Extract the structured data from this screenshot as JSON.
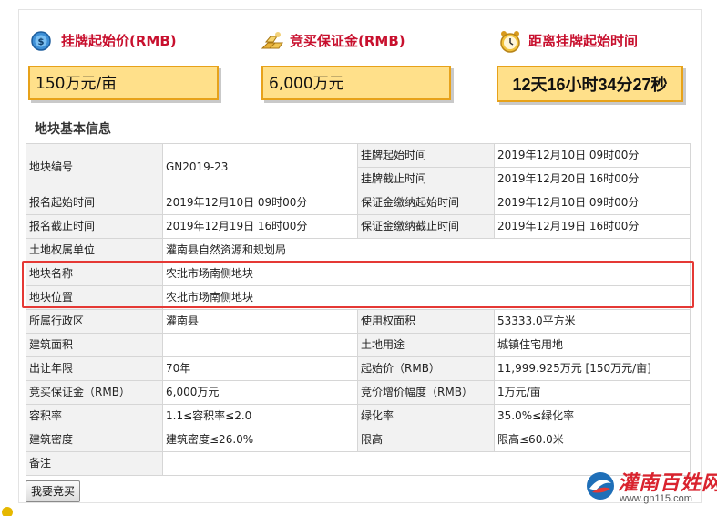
{
  "top": {
    "start_price": {
      "title": "挂牌起始价(RMB)",
      "value": "150万元/亩",
      "icon": "money-coin-icon"
    },
    "deposit": {
      "title": "竞买保证金(RMB)",
      "value": "6,000万元",
      "icon": "gold-bars-icon"
    },
    "countdown": {
      "title": "距离挂牌起始时间",
      "value": "12天16小时34分27秒",
      "icon": "alarm-clock-icon"
    }
  },
  "section_title": "地块基本信息",
  "table": {
    "parcel_no_label": "地块编号",
    "parcel_no": "GN2019-23",
    "listing_start_label": "挂牌起始时间",
    "listing_start": "2019年12月10日 09时00分",
    "listing_end_label": "挂牌截止时间",
    "listing_end": "2019年12月20日 16时00分",
    "reg_start_label": "报名起始时间",
    "reg_start": "2019年12月10日 09时00分",
    "deposit_start_label": "保证金缴纳起始时间",
    "deposit_start": "2019年12月10日 09时00分",
    "reg_end_label": "报名截止时间",
    "reg_end": "2019年12月19日 16时00分",
    "deposit_end_label": "保证金缴纳截止时间",
    "deposit_end": "2019年12月19日 16时00分",
    "owner_label": "土地权属单位",
    "owner": "灌南县自然资源和规划局",
    "name_label": "地块名称",
    "name": "农批市场南侧地块",
    "location_label": "地块位置",
    "location": "农批市场南侧地块",
    "district_label": "所属行政区",
    "district": "灌南县",
    "area_label": "使用权面积",
    "area": "53333.0平方米",
    "building_area_label": "建筑面积",
    "building_area": "",
    "land_use_label": "土地用途",
    "land_use": "城镇住宅用地",
    "term_label": "出让年限",
    "term": "70年",
    "start_price_label": "起始价（RMB）",
    "start_price": "11,999.925万元 [150万元/亩]",
    "bid_deposit_label": "竞买保证金（RMB）",
    "bid_deposit": "6,000万元",
    "increment_label": "竞价增价幅度（RMB）",
    "increment": "1万元/亩",
    "far_label": "容积率",
    "far": "1.1≤容积率≤2.0",
    "green_label": "绿化率",
    "green": "35.0%≤绿化率",
    "density_label": "建筑密度",
    "density": "建筑密度≤26.0%",
    "height_label": "限高",
    "height": "限高≤60.0米",
    "remark_label": "备注",
    "remark": ""
  },
  "bid_button": "我要竞买",
  "watermark": {
    "brand": "灌南百姓网",
    "url": "www.gn115.com"
  },
  "colors": {
    "accent_red": "#c8102e",
    "box_fill": "#ffe08a",
    "box_border": "#e7a21a",
    "highlight": "#e53935"
  }
}
